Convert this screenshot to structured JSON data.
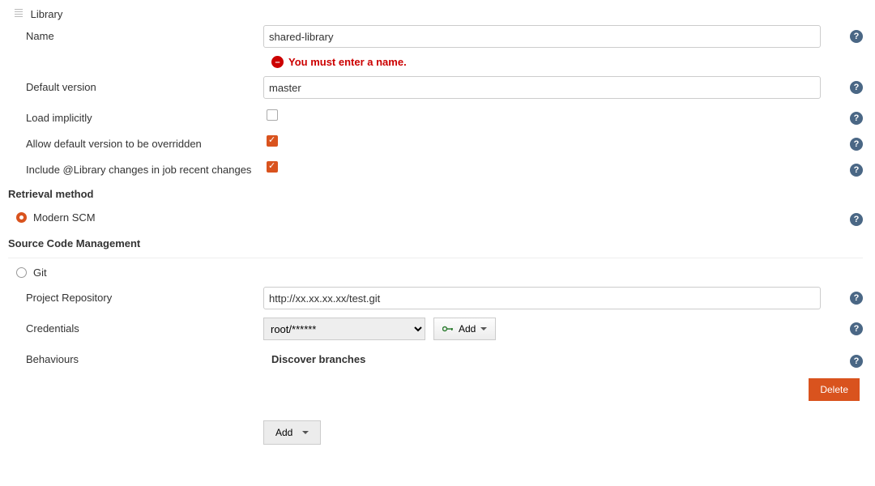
{
  "library": {
    "section_label": "Library",
    "name_label": "Name",
    "name_value": "shared-library",
    "name_error": "You must enter a name.",
    "default_version_label": "Default version",
    "default_version_value": "master",
    "load_implicitly_label": "Load implicitly",
    "load_implicitly_checked": false,
    "allow_override_label": "Allow default version to be overridden",
    "allow_override_checked": true,
    "include_changes_label": "Include @Library changes in job recent changes",
    "include_changes_checked": true
  },
  "retrieval": {
    "heading": "Retrieval method",
    "modern_scm_label": "Modern SCM",
    "modern_scm_checked": true
  },
  "scm": {
    "heading": "Source Code Management",
    "git_label": "Git",
    "git_checked": false,
    "repo_label": "Project Repository",
    "repo_value": "http://xx.xx.xx.xx/test.git",
    "credentials_label": "Credentials",
    "credentials_value": "root/******",
    "add_credentials_label": "Add",
    "behaviours_label": "Behaviours",
    "discover_branches_label": "Discover branches",
    "delete_label": "Delete",
    "add_behaviour_label": "Add"
  },
  "colors": {
    "accent": "#d9531e",
    "error": "#c00",
    "help_bg": "#4a6785"
  }
}
